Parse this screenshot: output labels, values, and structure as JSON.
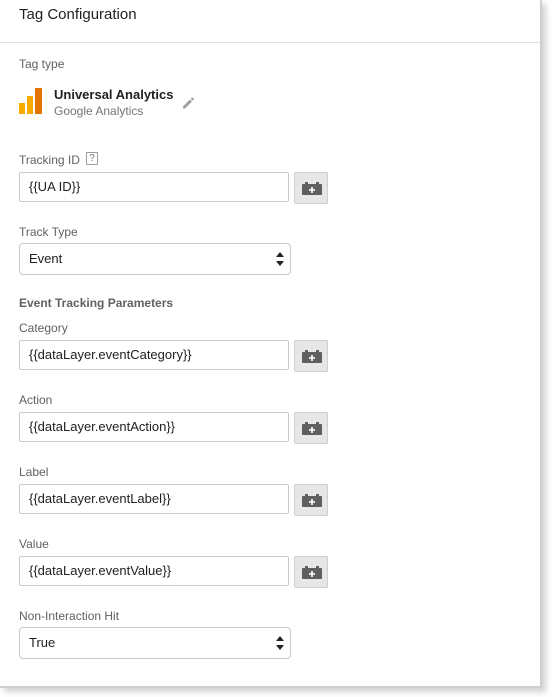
{
  "header": {
    "title": "Tag Configuration"
  },
  "tag_type": {
    "label": "Tag type",
    "name": "Universal Analytics",
    "vendor": "Google Analytics",
    "icon": "google-analytics-logo",
    "edit_icon": "pencil-icon",
    "colors": {
      "logo_dark": "#e37400",
      "logo_light": "#f9ab00"
    }
  },
  "tracking_id": {
    "label": "Tracking ID",
    "help": "?",
    "value": "{{UA ID}}"
  },
  "track_type": {
    "label": "Track Type",
    "value": "Event"
  },
  "event_section": {
    "title": "Event Tracking Parameters"
  },
  "category": {
    "label": "Category",
    "value": "{{dataLayer.eventCategory}}"
  },
  "action": {
    "label": "Action",
    "value": "{{dataLayer.eventAction}}"
  },
  "event_label": {
    "label": "Label",
    "value": "{{dataLayer.eventLabel}}"
  },
  "event_value": {
    "label": "Value",
    "value": "{{dataLayer.eventValue}}"
  },
  "non_interaction": {
    "label": "Non-Interaction Hit",
    "value": "True"
  },
  "variable_button_icon": "variable-picker-icon"
}
